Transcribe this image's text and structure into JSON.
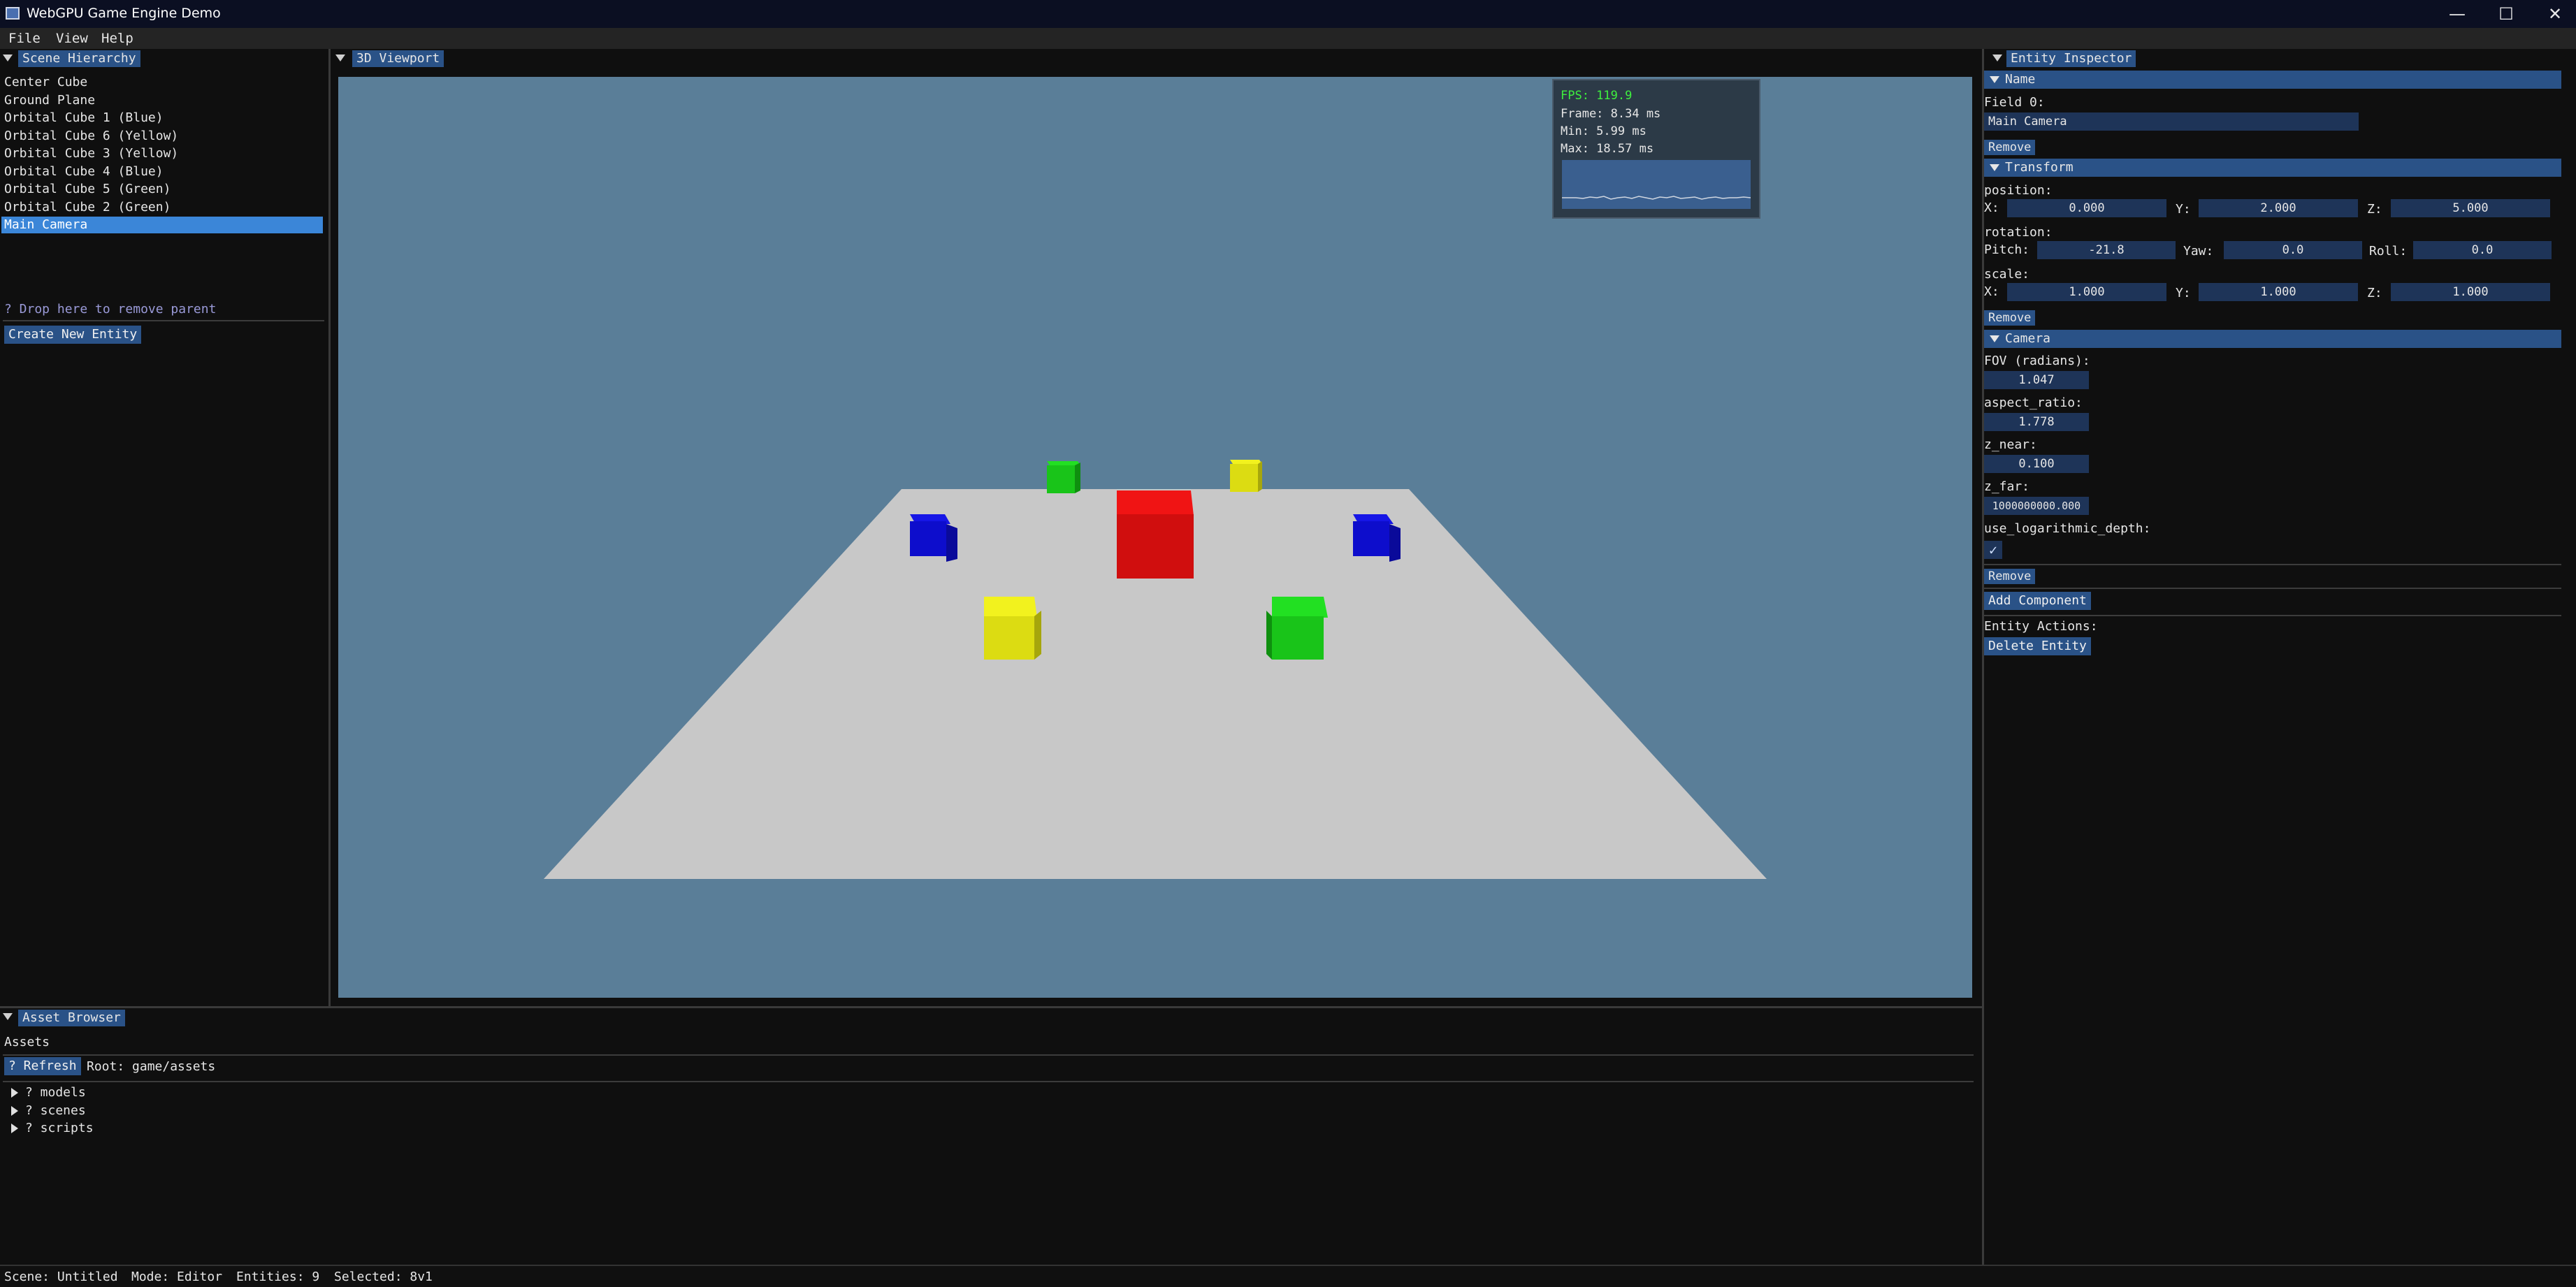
{
  "window": {
    "title": "WebGPU Game Engine Demo",
    "controls": {
      "minimize": "—",
      "maximize": "☐",
      "close": "✕"
    }
  },
  "menu": [
    "File",
    "View",
    "Help"
  ],
  "hierarchy": {
    "tab": "Scene Hierarchy",
    "items": [
      "Center Cube",
      "Ground Plane",
      "Orbital Cube 1 (Blue)",
      "Orbital Cube 6 (Yellow)",
      "Orbital Cube 3 (Yellow)",
      "Orbital Cube 4 (Blue)",
      "Orbital Cube 5 (Green)",
      "Orbital Cube 2 (Green)",
      "Main Camera"
    ],
    "selected_index": 8,
    "drop_hint": "? Drop here to remove parent",
    "create_button": "Create New Entity"
  },
  "viewport": {
    "tab": "3D Viewport",
    "background_color": "#5a7e98",
    "stats": {
      "fps": "FPS: 119.9",
      "frame": "Frame: 8.34 ms",
      "min": "Min: 5.99 ms",
      "max": "Max: 18.57 ms"
    }
  },
  "inspector": {
    "tab": "Entity Inspector",
    "name_section": {
      "header": "Name",
      "field_label": "Field 0:",
      "value": "Main Camera",
      "remove": "Remove"
    },
    "transform": {
      "header": "Transform",
      "position_label": "position:",
      "position": {
        "x_label": "X:",
        "x": "0.000",
        "y_label": "Y:",
        "y": "2.000",
        "z_label": "Z:",
        "z": "5.000"
      },
      "rotation_label": "rotation:",
      "rotation": {
        "pitch_label": "Pitch:",
        "pitch": "-21.8",
        "yaw_label": "Yaw:",
        "yaw": "0.0",
        "roll_label": "Roll:",
        "roll": "0.0"
      },
      "scale_label": "scale:",
      "scale": {
        "x_label": "X:",
        "x": "1.000",
        "y_label": "Y:",
        "y": "1.000",
        "z_label": "Z:",
        "z": "1.000"
      },
      "remove": "Remove"
    },
    "camera": {
      "header": "Camera",
      "fov_label": "FOV (radians):",
      "fov": "1.047",
      "aspect_label": "aspect_ratio:",
      "aspect": "1.778",
      "znear_label": "z_near:",
      "znear": "0.100",
      "zfar_label": "z_far:",
      "zfar": "1000000000.000",
      "log_label": "use_logarithmic_depth:",
      "log_checked": true,
      "remove": "Remove"
    },
    "add_component": "Add Component",
    "actions_label": "Entity Actions:",
    "delete_entity": "Delete Entity"
  },
  "assets": {
    "tab": "Asset Browser",
    "heading": "Assets",
    "refresh": "? Refresh",
    "root": "Root: game/assets",
    "folders": [
      "? models",
      "? scenes",
      "? scripts"
    ]
  },
  "statusbar": {
    "scene": "Scene: Untitled",
    "mode": "Mode: Editor",
    "entities": "Entities: 9",
    "selected": "Selected: 8v1"
  }
}
